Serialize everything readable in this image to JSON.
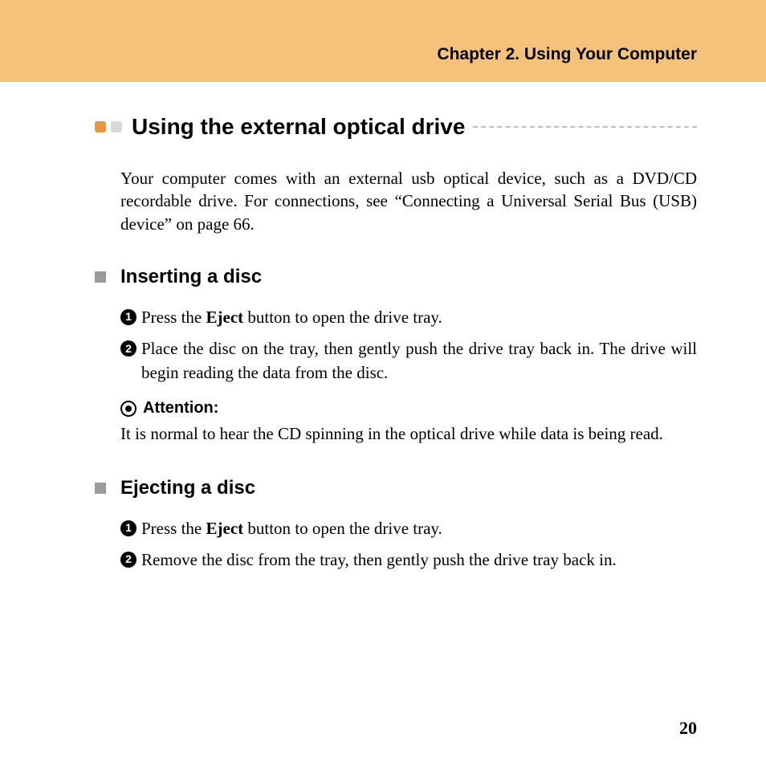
{
  "header": {
    "chapter_title": "Chapter 2. Using Your Computer"
  },
  "main": {
    "heading": "Using the external optical drive",
    "intro": "Your computer comes with an external usb optical device, such as a DVD/CD recordable drive. For connections, see “Connecting a Universal Serial Bus (USB) device” on page 66."
  },
  "inserting": {
    "heading": "Inserting a disc",
    "step1_pre": "Press the ",
    "step1_bold": "Eject",
    "step1_post": " button to open the drive tray.",
    "step2": "Place the disc on the tray, then gently push the drive tray back in. The drive will begin reading the data from the disc.",
    "attention_label": "Attention:",
    "attention_text": "It is normal to hear the CD spinning in the optical drive while data is being read."
  },
  "ejecting": {
    "heading": "Ejecting a disc",
    "step1_pre": "Press the ",
    "step1_bold": "Eject",
    "step1_post": " button to open the drive tray.",
    "step2": "Remove the disc from the tray, then gently push the drive tray back in."
  },
  "footer": {
    "page_number": "20"
  },
  "numbers": {
    "one": "1",
    "two": "2"
  }
}
